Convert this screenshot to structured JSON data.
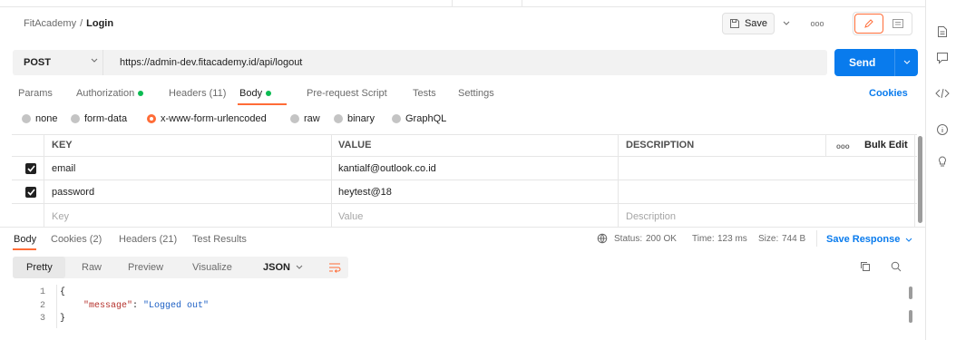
{
  "header": {
    "breadcrumb_collection": "FitAcademy",
    "breadcrumb_separator": "/",
    "breadcrumb_request": "Login",
    "save_label": "Save",
    "more_label": "ooo"
  },
  "request": {
    "method": "POST",
    "url": "https://admin-dev.fitacademy.id/api/logout",
    "send_label": "Send"
  },
  "tabs": {
    "params": "Params",
    "authorization": "Authorization",
    "headers": "Headers (11)",
    "body": "Body",
    "prerequest": "Pre-request Script",
    "tests": "Tests",
    "settings": "Settings",
    "cookies": "Cookies",
    "active": "Body"
  },
  "body_types": {
    "none": "none",
    "form_data": "form-data",
    "urlencoded": "x-www-form-urlencoded",
    "raw": "raw",
    "binary": "binary",
    "graphql": "GraphQL",
    "selected": "x-www-form-urlencoded"
  },
  "table": {
    "headers": {
      "key": "KEY",
      "value": "VALUE",
      "description": "DESCRIPTION",
      "more": "ooo",
      "bulk_edit": "Bulk Edit"
    },
    "rows": [
      {
        "checked": true,
        "key": "email",
        "value": "kantialf@outlook.co.id",
        "description": ""
      },
      {
        "checked": true,
        "key": "password",
        "value": "heytest@18",
        "description": ""
      }
    ],
    "placeholder": {
      "key": "Key",
      "value": "Value",
      "description": "Description"
    }
  },
  "response": {
    "tabs": {
      "body": "Body",
      "cookies": "Cookies (2)",
      "headers": "Headers (21)",
      "test_results": "Test Results"
    },
    "status_label": "Status:",
    "status_value": "200 OK",
    "time_label": "Time:",
    "time_value": "123 ms",
    "size_label": "Size:",
    "size_value": "744 B",
    "save_response": "Save Response",
    "view_tabs": {
      "pretty": "Pretty",
      "raw": "Raw",
      "preview": "Preview",
      "visualize": "Visualize"
    },
    "format": "JSON",
    "lines": {
      "n1": "1",
      "n2": "2",
      "n3": "3",
      "open": "{",
      "key": "\"message\"",
      "colon": ": ",
      "value": "\"Logged out\"",
      "close": "}"
    }
  },
  "colors": {
    "accent": "#ff6c37",
    "send_blue": "#097bed",
    "status_green": "#0cbb52"
  }
}
